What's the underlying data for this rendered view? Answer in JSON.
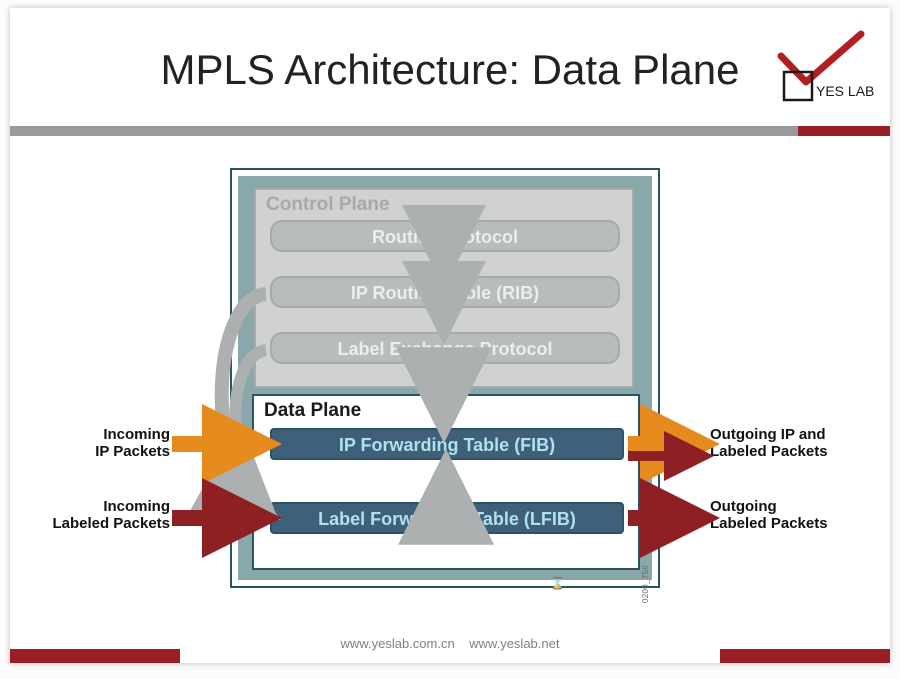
{
  "title": "MPLS Architecture: Data Plane",
  "brand": {
    "label": "YES LAB"
  },
  "control_plane": {
    "title": "Control Plane",
    "box1": "Routing Protocol",
    "box2": "IP Routing Table (RIB)",
    "box3": "Label  Exchange Protocol"
  },
  "data_plane": {
    "title": "Data Plane",
    "fib": "IP Forwarding Table (FIB)",
    "lfib": "Label Forwarding Table (LFIB)"
  },
  "labels": {
    "in_ip": "Incoming\nIP Packets",
    "in_lbl": "Incoming\nLabeled Packets",
    "out_ip": "Outgoing IP and\nLabeled Packets",
    "out_lbl": "Outgoing\nLabeled Packets"
  },
  "footer": {
    "url1": "www.yeslab.com.cn",
    "url2": "www.yeslab.net"
  },
  "code": "0200_756",
  "colors": {
    "accent": "#9a1f24",
    "orange": "#e58a1d",
    "red": "#8e1f22",
    "grey_arrow": "#adb0b0",
    "teal": "#3f5f7a"
  }
}
